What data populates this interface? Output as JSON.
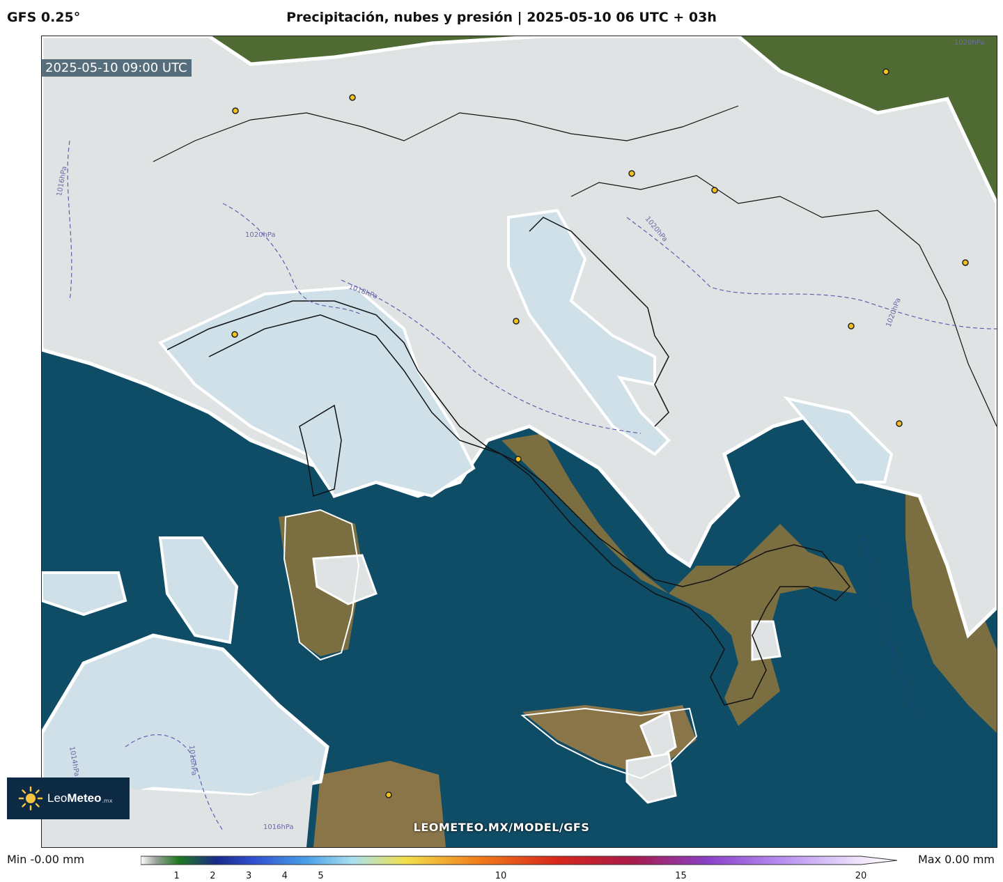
{
  "header": {
    "model": "GFS 0.25°",
    "title": "Precipitación, nubes y presión | 2025-05-10 06 UTC + 03h"
  },
  "map": {
    "timestamp": "2025-05-10 09:00 UTC",
    "isobar_labels": [
      "1020hPa",
      "1016hPa",
      "1020hPa",
      "1018hPa",
      "1020hPa",
      "1020hPa",
      "1014hPa",
      "1016hPa",
      "1016hPa"
    ],
    "watermark": "LEOMETEO.MX/MODEL/GFS"
  },
  "logo": {
    "name_light": "Leo",
    "name_bold": "Meteo",
    "tld": ".mx"
  },
  "legend": {
    "min_label": "Min -0.00 mm",
    "max_label": "Max 0.00 mm",
    "ticks": [
      "1",
      "2",
      "3",
      "4",
      "5",
      "10",
      "15",
      "20"
    ],
    "tick_values": [
      1,
      2,
      3,
      4,
      5,
      10,
      15,
      20
    ],
    "range": [
      0,
      20
    ]
  },
  "colors": {
    "sea": "#0f4c66",
    "cloud": "#dfe3e3",
    "light_cloud": "#cfe0e8",
    "land": "#6b7a45",
    "isobar": "#5f5fb0"
  }
}
